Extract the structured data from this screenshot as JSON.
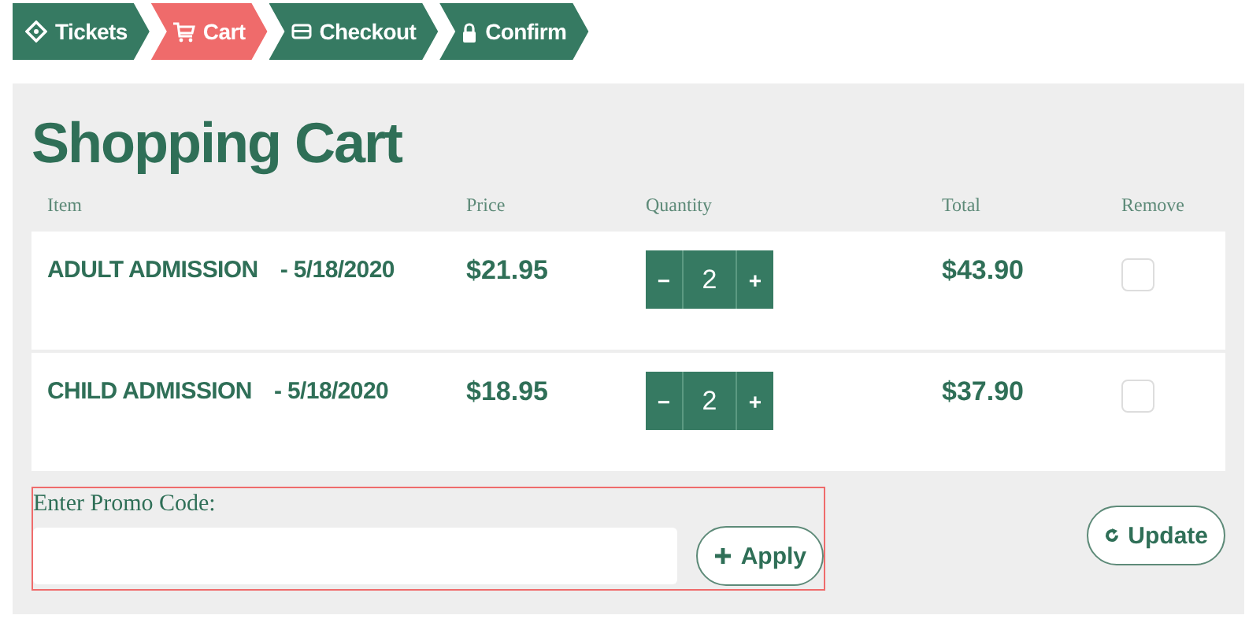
{
  "steps": [
    {
      "label": "Tickets",
      "kind": "ticket",
      "selected": false
    },
    {
      "label": "Cart",
      "kind": "cart",
      "selected": true
    },
    {
      "label": "Checkout",
      "kind": "card",
      "selected": false
    },
    {
      "label": "Confirm",
      "kind": "lock",
      "selected": false
    }
  ],
  "title": "Shopping Cart",
  "columns": [
    "Item",
    "Price",
    "Quantity",
    "Total",
    "Remove"
  ],
  "rows": [
    {
      "item": "ADULT ADMISSION",
      "date": "- 5/18/2020",
      "price": "$21.95",
      "minus": "−",
      "quantity": "2",
      "plus": "+",
      "total": "$43.90",
      "remove": false
    },
    {
      "item": "CHILD ADMISSION",
      "date": "- 5/18/2020",
      "price": "$18.95",
      "minus": "−",
      "quantity": "2",
      "plus": "+",
      "total": "$37.90",
      "remove": false
    }
  ],
  "promo": {
    "label": "Enter Promo Code:",
    "apply": "Apply"
  },
  "update": "Update"
}
